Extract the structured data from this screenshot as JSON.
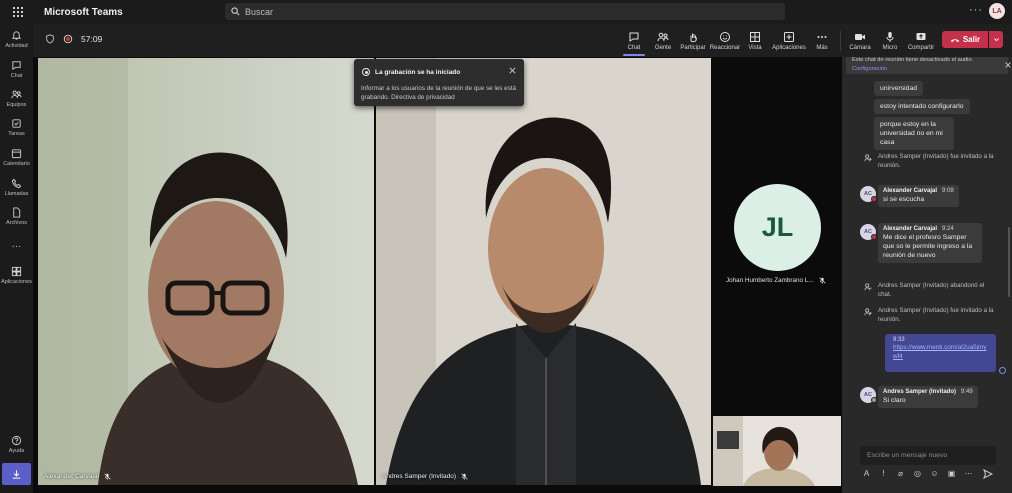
{
  "titlebar": {
    "app_title": "Microsoft Teams",
    "search_placeholder": "Buscar",
    "more": "···",
    "avatar_initials": "LA"
  },
  "rail": {
    "items": [
      {
        "label": "Actividad",
        "icon": "bell-icon"
      },
      {
        "label": "Chat",
        "icon": "chat-icon"
      },
      {
        "label": "Equipos",
        "icon": "teams-icon"
      },
      {
        "label": "Tareas",
        "icon": "tasks-icon"
      },
      {
        "label": "Calendario",
        "icon": "calendar-icon"
      },
      {
        "label": "Llamadas",
        "icon": "phone-icon"
      },
      {
        "label": "Archivos",
        "icon": "file-icon"
      },
      {
        "label": "···",
        "icon": "more-icon"
      },
      {
        "label": "Aplicaciones",
        "icon": "apps-icon"
      },
      {
        "label": "Ayuda",
        "icon": "help-icon"
      }
    ],
    "download_icon": "download-icon"
  },
  "toolbar": {
    "timer": "57:09",
    "buttons": [
      {
        "label": "Chat",
        "icon": "chat-icon",
        "active": true
      },
      {
        "label": "Gente",
        "icon": "people-icon"
      },
      {
        "label": "Participar",
        "icon": "raise-hand-icon"
      },
      {
        "label": "Reaccionar",
        "icon": "emoji-icon"
      },
      {
        "label": "Vista",
        "icon": "grid-view-icon"
      },
      {
        "label": "Aplicaciones",
        "icon": "add-app-icon"
      },
      {
        "label": "Más",
        "icon": "more-icon"
      },
      {
        "label": "Cámara",
        "icon": "camera-icon"
      },
      {
        "label": "Micro",
        "icon": "mic-icon"
      },
      {
        "label": "Compartir",
        "icon": "share-icon"
      }
    ],
    "leave_label": "Salir"
  },
  "stage": {
    "tiles": [
      {
        "name": "Alexander Carvajal"
      },
      {
        "name": "Andres Samper (Invitado)"
      }
    ],
    "toast": {
      "title": "La grabación se ha iniciado",
      "body": "Informar a los usuarios de la reunión de que se les está grabando. Directiva de privacidad"
    },
    "avatar_tile": {
      "initials": "JL",
      "name": "Johan Humberto Zambrano L..."
    }
  },
  "chat": {
    "banner_text": "Este chat de reunión tiene desactivado el audio.",
    "banner_link": "Configuración",
    "bubbles": [
      "unirversidad",
      "estoy intentado configurarlo",
      "porque estoy en la universidad no en mi casa"
    ],
    "system_1": "Andres Samper (Invitado) fue invitado a la reunión.",
    "msg1": {
      "initials": "AC",
      "author": "Alexander Carvajal",
      "time": "9:08",
      "text": "si se escucha"
    },
    "msg2": {
      "initials": "AC",
      "author": "Alexander Carvajal",
      "time": "9:24",
      "text": "Me dice el profesro Samper que so le permite ingreso a la reunión  de nuevo"
    },
    "system_2": "Andres Samper (Invitado) abandonó el chat.",
    "system_3": "Andres Samper (Invitado) fue invitado a la reunión.",
    "self_msg": {
      "time": "9:33",
      "link": "https://www.menti.com/al2ua5jmywf4"
    },
    "msg3": {
      "initials": "AC",
      "author": "Andres Samper (Invitado)",
      "time": "9:49",
      "text": "Si claro"
    },
    "compose_placeholder": "Escribe un mensaje nuevo"
  },
  "colors": {
    "accent": "#5b5fc7",
    "leave_red": "#c4314b",
    "self_bubble": "#444791"
  }
}
